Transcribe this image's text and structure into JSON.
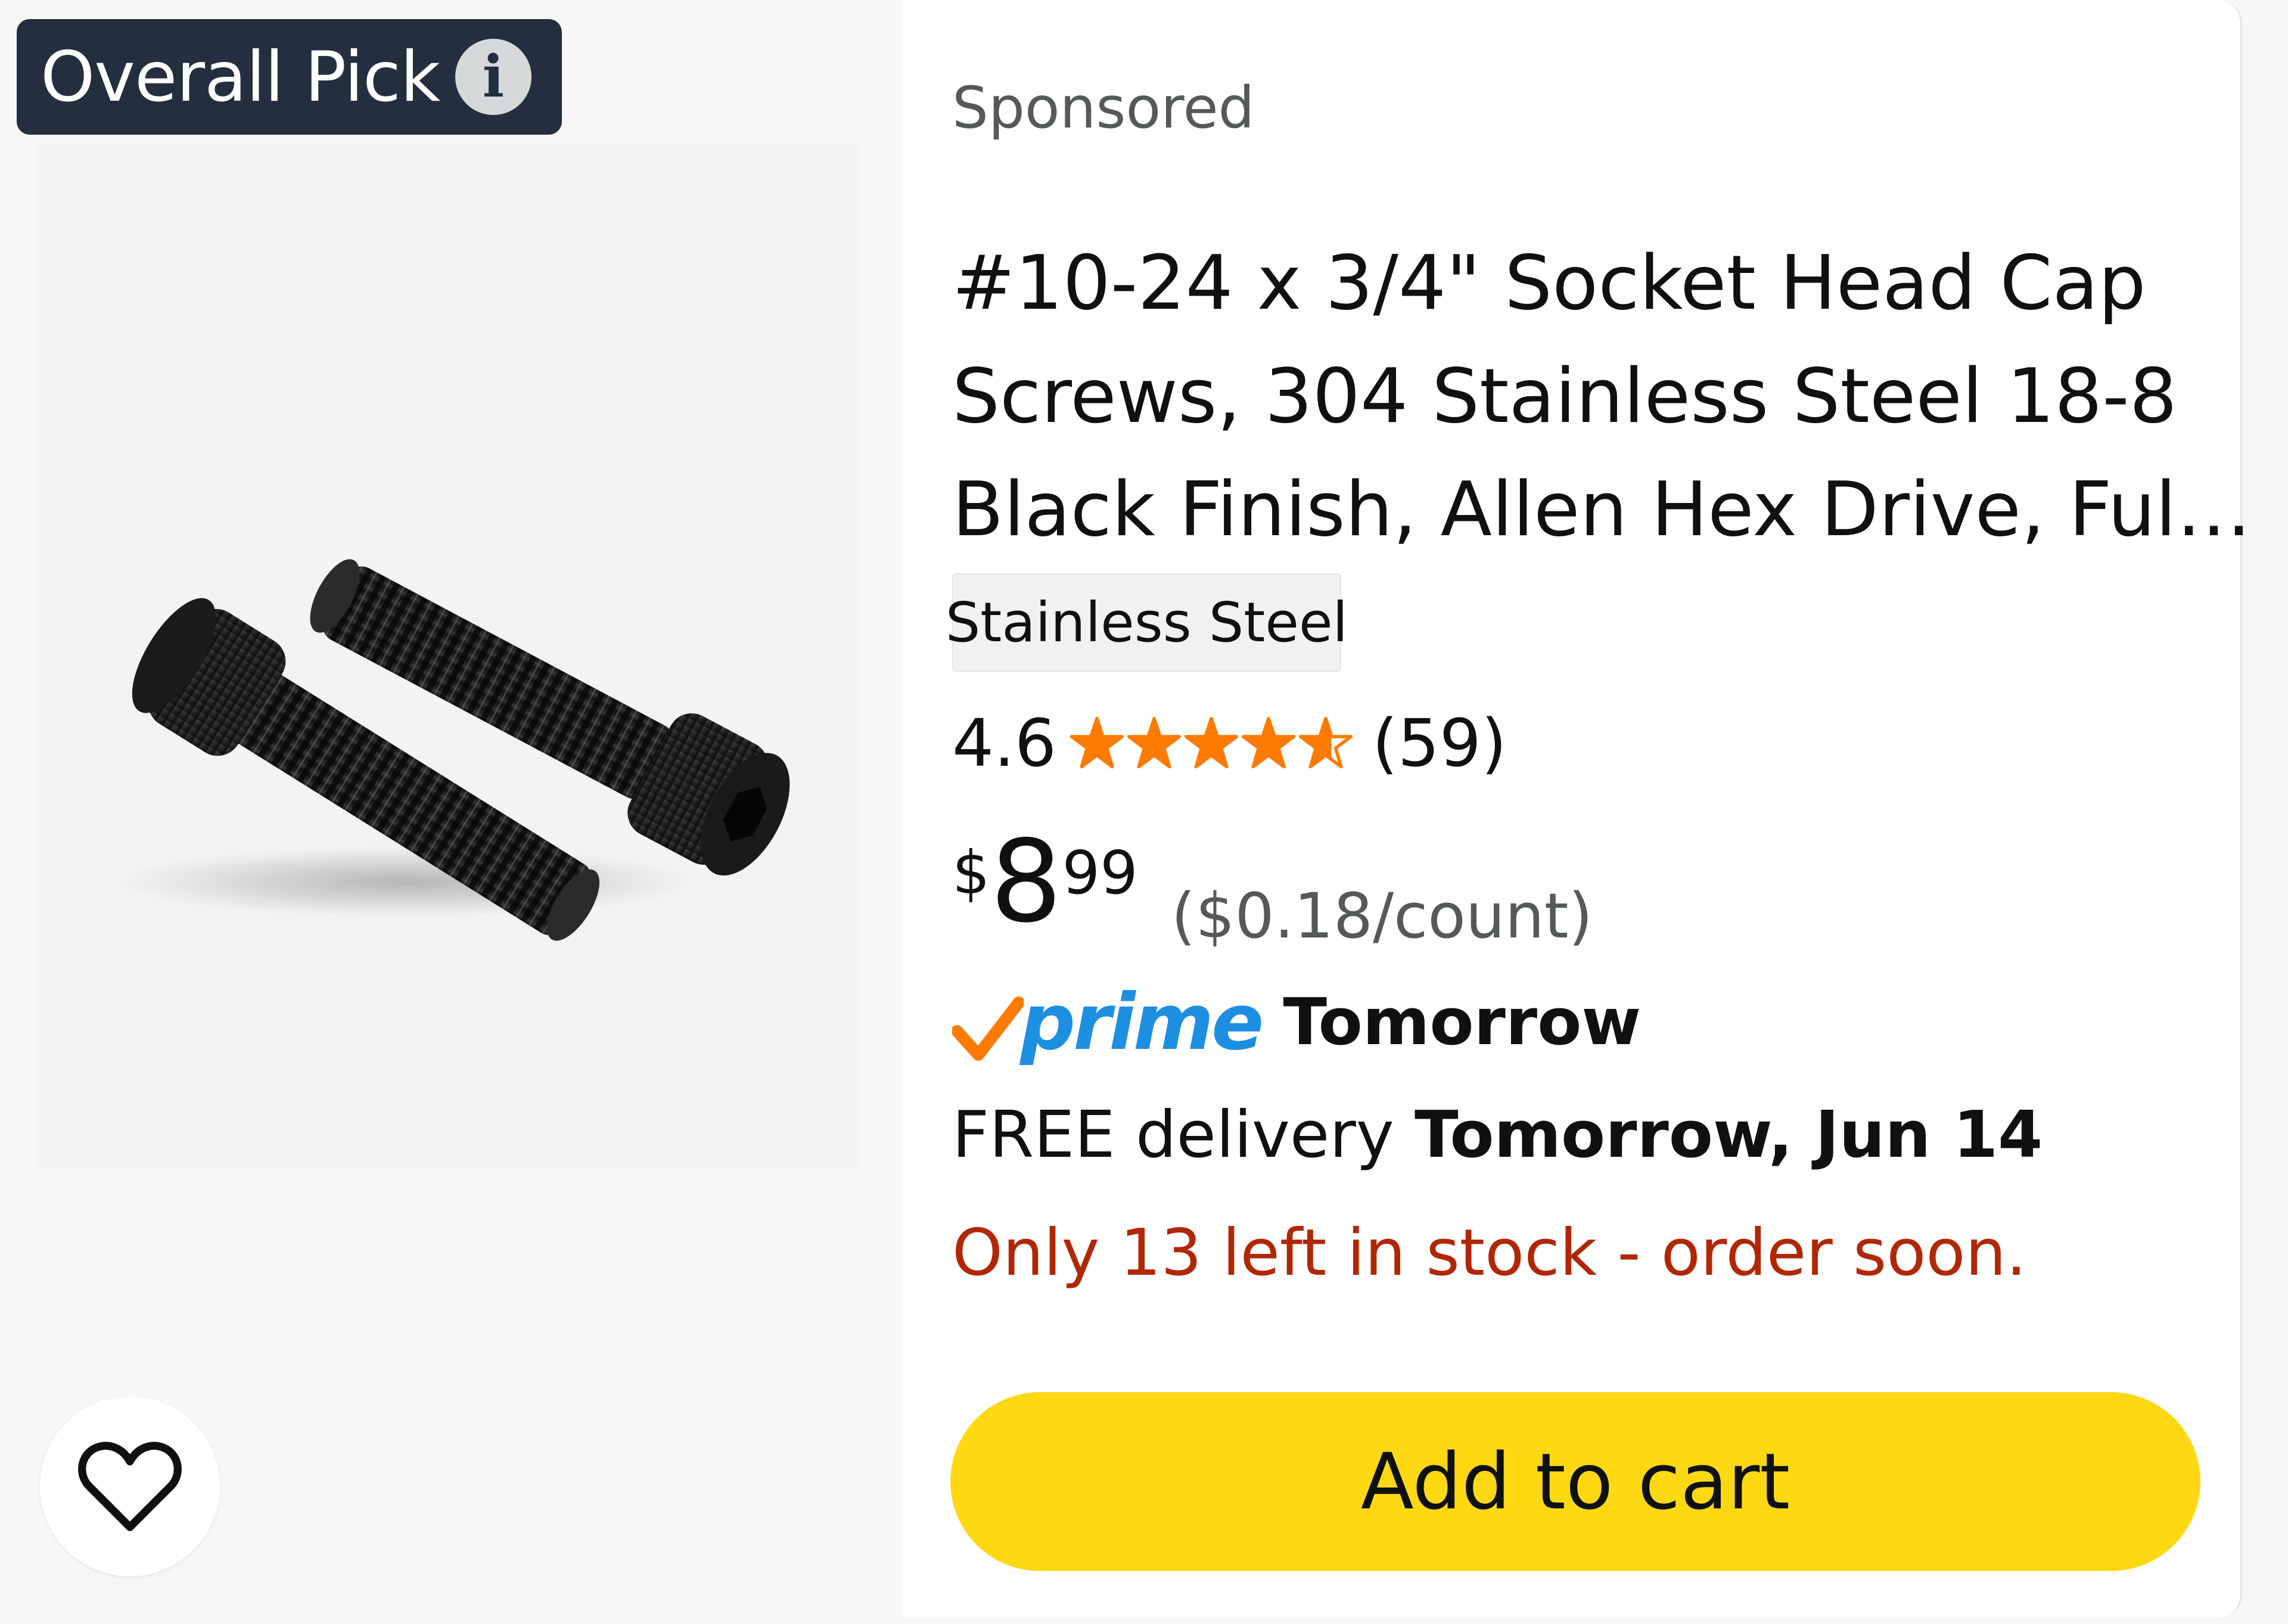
{
  "badge": {
    "label": "Overall Pick",
    "info_icon": "info-icon"
  },
  "product": {
    "sponsored_label": "Sponsored",
    "title_lines": [
      "#10-24 x 3/4\" Socket Head Cap",
      "Screws, 304 Stainless Steel 18-8",
      "Black Finish, Allen Hex Drive, Ful…"
    ],
    "variant": "Stainless Steel",
    "rating": {
      "value": "4.6",
      "stars": 4.6,
      "review_count": "(59)"
    },
    "price": {
      "symbol": "$",
      "whole": "8",
      "fraction": "99",
      "unit_price": "($0.18/count)"
    },
    "prime": {
      "logo_text": "prime",
      "delivery_speed": "Tomorrow"
    },
    "delivery": {
      "prefix": "FREE delivery ",
      "date": "Tomorrow, Jun 14"
    },
    "stock": "Only 13 left in stock - order soon.",
    "add_to_cart_label": "Add to cart",
    "wishlist_icon": "heart-icon"
  },
  "colors": {
    "badge_bg": "#232f3e",
    "star": "#ff7a00",
    "prime_blue": "#1d8fe1",
    "prime_check": "#ff7a00",
    "stock_red": "#b12704",
    "cart_button": "#ffd814"
  }
}
